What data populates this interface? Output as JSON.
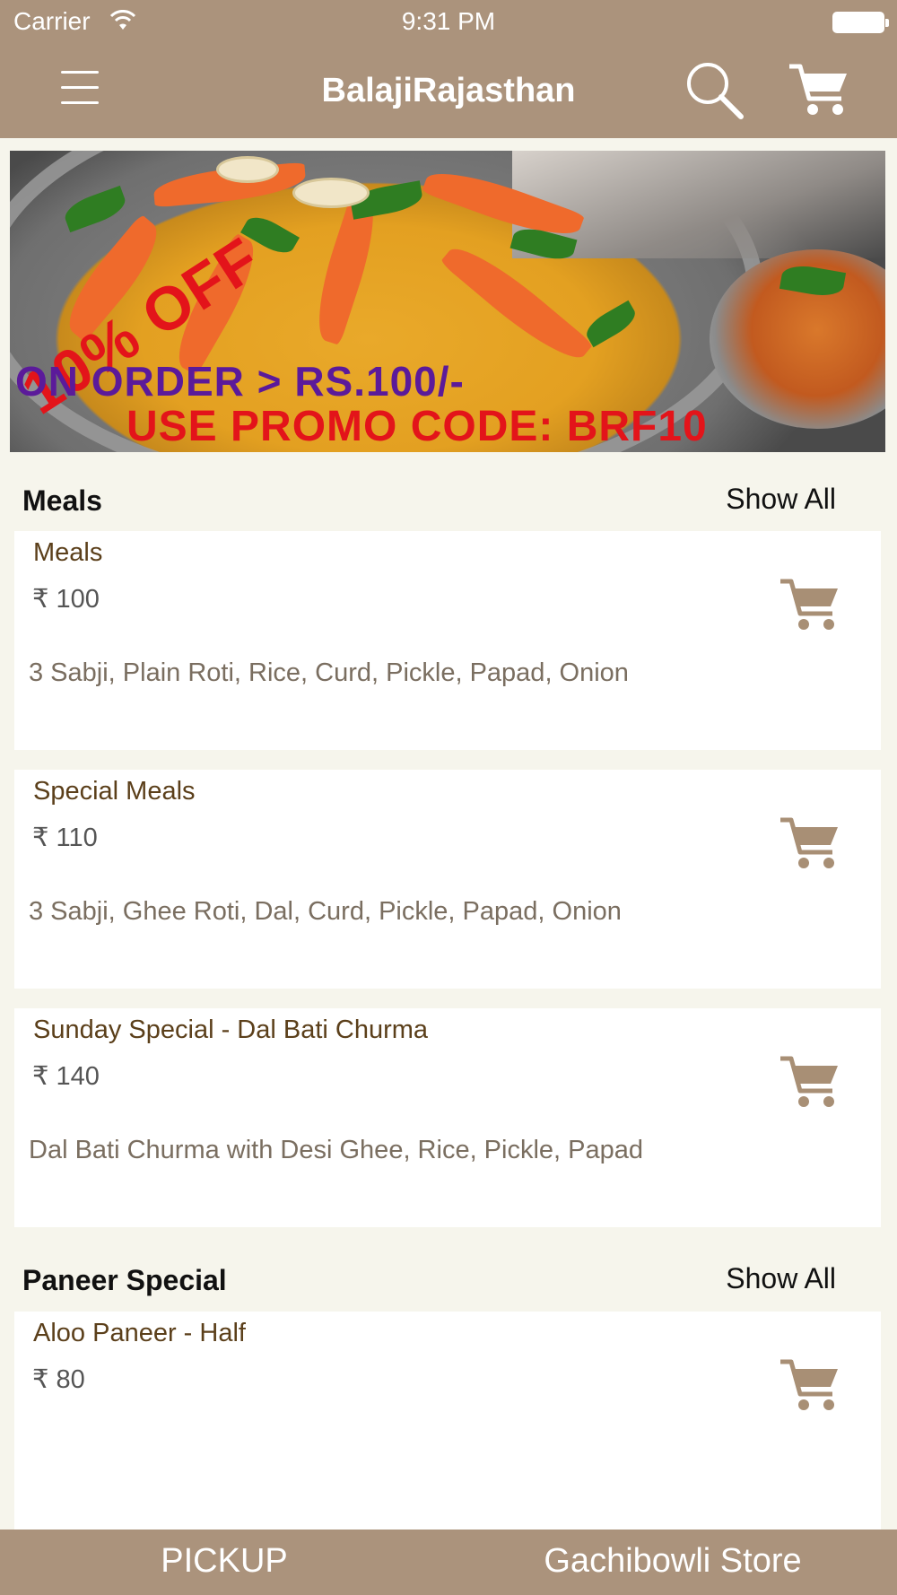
{
  "status_bar": {
    "carrier": "Carrier",
    "time": "9:31 PM"
  },
  "navbar": {
    "title": "BalajiRajasthan",
    "menu_icon": "hamburger-menu-icon",
    "search_icon": "search-icon",
    "cart_icon": "cart-icon"
  },
  "banner": {
    "discount": "10% OFF",
    "condition": "ON ORDER > RS.100/-",
    "promo": "USE PROMO CODE: BRF10"
  },
  "sections": [
    {
      "title": "Meals",
      "show_all": "Show All",
      "items": [
        {
          "name": "Meals",
          "price": "₹ 100",
          "description": "3 Sabji, Plain Roti, Rice, Curd, Pickle, Papad, Onion"
        },
        {
          "name": "Special Meals",
          "price": "₹ 110",
          "description": "3 Sabji, Ghee Roti, Dal, Curd, Pickle, Papad, Onion"
        },
        {
          "name": "Sunday Special - Dal Bati Churma",
          "price": "₹ 140",
          "description": "Dal Bati Churma with Desi Ghee, Rice, Pickle, Papad"
        }
      ]
    },
    {
      "title": "Paneer Special",
      "show_all": "Show All",
      "items": [
        {
          "name": "Aloo Paneer - Half",
          "price": "₹ 80",
          "description": ""
        }
      ]
    }
  ],
  "bottom_bar": {
    "pickup": "PICKUP",
    "store": "Gachibowli Store"
  },
  "colors": {
    "bar_brown": "#ab937c",
    "background": "#f6f5ec",
    "item_name": "#5b3f1a",
    "cart_icon": "#a88f75"
  }
}
